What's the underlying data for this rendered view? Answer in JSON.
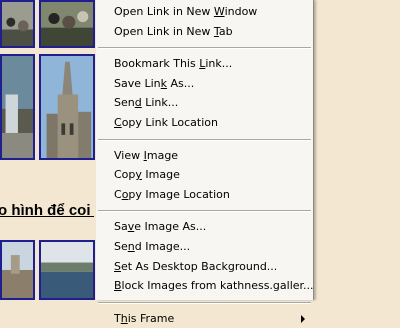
{
  "page": {
    "caption": "o hình để coi h"
  },
  "context_menu": {
    "groups": [
      [
        {
          "label": "Open Link in New Window",
          "mnemonic": "W"
        },
        {
          "label": "Open Link in New Tab",
          "mnemonic": "T"
        }
      ],
      [
        {
          "label": "Bookmark This Link...",
          "mnemonic": "L"
        },
        {
          "label": "Save Link As...",
          "mnemonic": "k"
        },
        {
          "label": "Send Link...",
          "mnemonic": "d"
        },
        {
          "label": "Copy Link Location",
          "mnemonic": "C"
        }
      ],
      [
        {
          "label": "View Image",
          "mnemonic": "I"
        },
        {
          "label": "Copy Image",
          "mnemonic": "y"
        },
        {
          "label": "Copy Image Location",
          "mnemonic": "o"
        }
      ],
      [
        {
          "label": "Save Image As...",
          "mnemonic": "v"
        },
        {
          "label": "Send Image...",
          "mnemonic": "n"
        },
        {
          "label": "Set As Desktop Background...",
          "mnemonic": "S"
        },
        {
          "label": "Block Images from kathness.galler...",
          "mnemonic": "B"
        }
      ],
      [
        {
          "label": "This Frame",
          "mnemonic": "h",
          "submenu": true
        }
      ]
    ]
  },
  "colors": {
    "page_background": "#f3e7d1",
    "menu_background": "#f7f6f2",
    "thumbnail_border": "#1f1f8f"
  }
}
